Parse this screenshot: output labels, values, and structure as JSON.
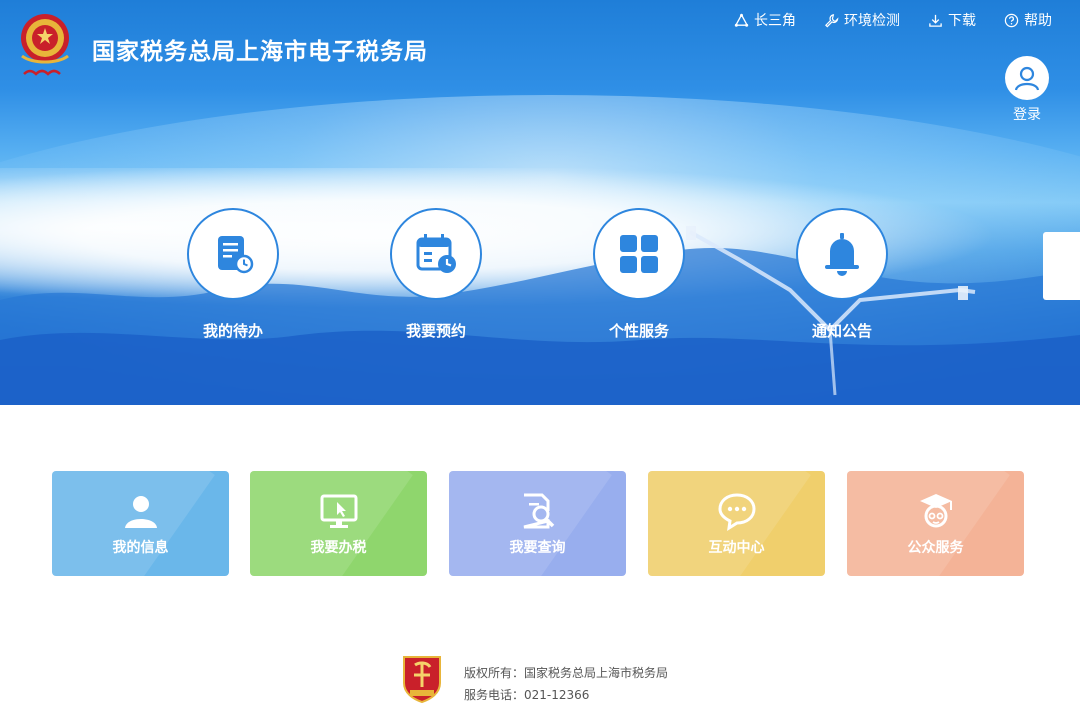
{
  "header": {
    "title": "国家税务总局上海市电子税务局"
  },
  "topnav": [
    {
      "label": "长三角",
      "icon": "triangle-nodes-icon"
    },
    {
      "label": "环境检测",
      "icon": "wrench-icon"
    },
    {
      "label": "下载",
      "icon": "download-icon"
    },
    {
      "label": "帮助",
      "icon": "help-circle-icon"
    }
  ],
  "login": {
    "label": "登录"
  },
  "quick_actions": [
    {
      "label": "我的待办",
      "icon": "todo-list-icon"
    },
    {
      "label": "我要预约",
      "icon": "calendar-clock-icon"
    },
    {
      "label": "个性服务",
      "icon": "grid-apps-icon"
    },
    {
      "label": "通知公告",
      "icon": "bell-icon"
    }
  ],
  "tiles": [
    {
      "label": "我的信息",
      "icon": "user-icon",
      "color": "#6ab7ea"
    },
    {
      "label": "我要办税",
      "icon": "monitor-cursor-icon",
      "color": "#8fd66d"
    },
    {
      "label": "我要查询",
      "icon": "document-search-icon",
      "color": "#98aeee"
    },
    {
      "label": "互动中心",
      "icon": "chat-bubble-icon",
      "color": "#f0cf6c"
    },
    {
      "label": "公众服务",
      "icon": "graduate-icon",
      "color": "#f4b397"
    }
  ],
  "footer": {
    "copyright": "版权所有：国家税务总局上海市税务局",
    "phone": "服务电话：021-12366"
  },
  "colors": {
    "brand_blue": "#1f7ed8",
    "icon_blue": "#2e86de"
  }
}
